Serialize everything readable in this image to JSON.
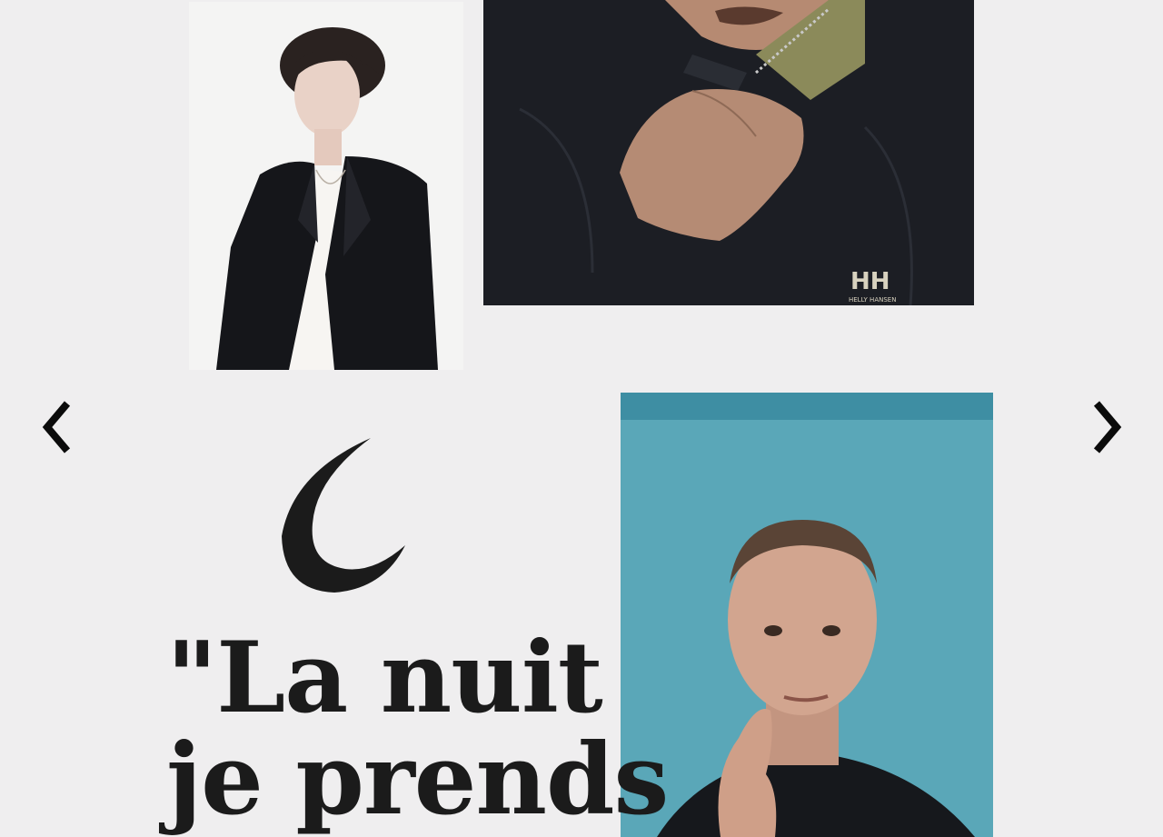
{
  "carousel": {
    "prev_icon": "chevron-left-icon",
    "next_icon": "chevron-right-icon"
  },
  "photos": [
    {
      "id": "woman",
      "background": "#f4f4f3"
    },
    {
      "id": "jacket",
      "background": "#1c1e24",
      "brand_logo": "HH",
      "brand_name": "HELLY HANSEN"
    },
    {
      "id": "man",
      "background": "#5aa7b8"
    }
  ],
  "icon": "crescent-moon-icon",
  "quote": {
    "line1": "\"La nuit",
    "line2": "je prends"
  },
  "colors": {
    "page_bg": "#efeeef",
    "text": "#1b1b1b",
    "teal_bg": "#5aa7b8"
  }
}
